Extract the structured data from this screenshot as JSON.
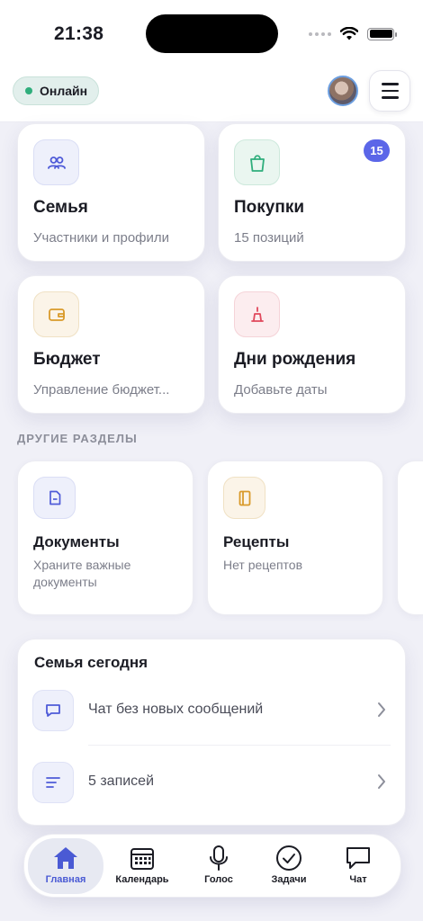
{
  "status_bar": {
    "time": "21:38"
  },
  "header": {
    "status_label": "Онлайн"
  },
  "tiles": [
    {
      "title": "Семья",
      "subtitle": "Участники и профили",
      "icon": "people-icon"
    },
    {
      "title": "Покупки",
      "subtitle": "15 позиций",
      "icon": "shopping-bag-icon",
      "badge": "15"
    },
    {
      "title": "Бюджет",
      "subtitle": "Управление бюджет...",
      "icon": "wallet-icon"
    },
    {
      "title": "Дни рождения",
      "subtitle": "Добавьте даты",
      "icon": "cake-icon"
    }
  ],
  "other_sections": {
    "label": "ДРУГИЕ РАЗДЕЛЫ",
    "items": [
      {
        "title": "Документы",
        "subtitle": "Храните важные документы",
        "icon": "document-icon"
      },
      {
        "title": "Рецепты",
        "subtitle": "Нет рецептов",
        "icon": "recipe-book-icon"
      }
    ]
  },
  "today": {
    "title": "Семья сегодня",
    "rows": [
      {
        "text": "Чат без новых сообщений",
        "icon": "chat-bubble-icon"
      },
      {
        "text": "5 записей",
        "icon": "notes-lines-icon"
      }
    ]
  },
  "tabbar": [
    {
      "label": "Главная",
      "icon": "home-icon",
      "active": true
    },
    {
      "label": "Календарь",
      "icon": "calendar-icon",
      "active": false
    },
    {
      "label": "Голос",
      "icon": "microphone-icon",
      "active": false
    },
    {
      "label": "Задачи",
      "icon": "checkmark-circle-icon",
      "active": false
    },
    {
      "label": "Чат",
      "icon": "chat-icon",
      "active": false
    }
  ],
  "colors": {
    "accent": "#5b66e8",
    "online": "#2fae7c",
    "background": "#f0f0f7"
  }
}
